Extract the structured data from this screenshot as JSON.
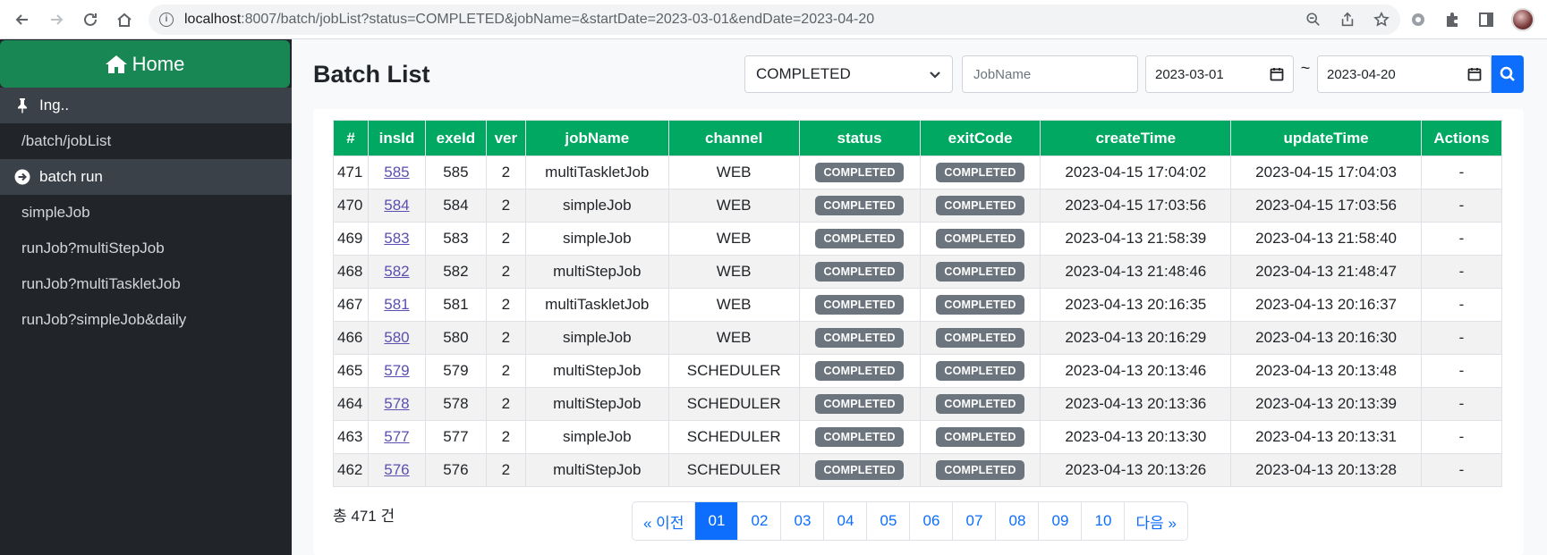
{
  "browser": {
    "url_host": "localhost",
    "url_rest": ":8007/batch/jobList?status=COMPLETED&jobName=&startDate=2023-03-01&endDate=2023-04-20"
  },
  "sidebar": {
    "home_label": "Home",
    "group_ing": "Ing..",
    "joblist_link": "/batch/jobList",
    "group_run": "batch run",
    "items": [
      "simpleJob",
      "runJob?multiStepJob",
      "runJob?multiTaskletJob",
      "runJob?simpleJob&daily"
    ]
  },
  "main": {
    "title": "Batch List",
    "status_select": "COMPLETED",
    "job_name_placeholder": "JobName",
    "start_date": "2023-03-01",
    "range_sep": "~",
    "end_date": "2023-04-20"
  },
  "table": {
    "headers": [
      "#",
      "insId",
      "exeId",
      "ver",
      "jobName",
      "channel",
      "status",
      "exitCode",
      "createTime",
      "updateTime",
      "Actions"
    ],
    "rows": [
      {
        "n": "471",
        "ins": "585",
        "exe": "585",
        "ver": "2",
        "job": "multiTaskletJob",
        "ch": "WEB",
        "status": "COMPLETED",
        "exit": "COMPLETED",
        "create": "2023-04-15 17:04:02",
        "update": "2023-04-15 17:04:03",
        "act": "-"
      },
      {
        "n": "470",
        "ins": "584",
        "exe": "584",
        "ver": "2",
        "job": "simpleJob",
        "ch": "WEB",
        "status": "COMPLETED",
        "exit": "COMPLETED",
        "create": "2023-04-15 17:03:56",
        "update": "2023-04-15 17:03:56",
        "act": "-"
      },
      {
        "n": "469",
        "ins": "583",
        "exe": "583",
        "ver": "2",
        "job": "simpleJob",
        "ch": "WEB",
        "status": "COMPLETED",
        "exit": "COMPLETED",
        "create": "2023-04-13 21:58:39",
        "update": "2023-04-13 21:58:40",
        "act": "-"
      },
      {
        "n": "468",
        "ins": "582",
        "exe": "582",
        "ver": "2",
        "job": "multiStepJob",
        "ch": "WEB",
        "status": "COMPLETED",
        "exit": "COMPLETED",
        "create": "2023-04-13 21:48:46",
        "update": "2023-04-13 21:48:47",
        "act": "-"
      },
      {
        "n": "467",
        "ins": "581",
        "exe": "581",
        "ver": "2",
        "job": "multiTaskletJob",
        "ch": "WEB",
        "status": "COMPLETED",
        "exit": "COMPLETED",
        "create": "2023-04-13 20:16:35",
        "update": "2023-04-13 20:16:37",
        "act": "-"
      },
      {
        "n": "466",
        "ins": "580",
        "exe": "580",
        "ver": "2",
        "job": "simpleJob",
        "ch": "WEB",
        "status": "COMPLETED",
        "exit": "COMPLETED",
        "create": "2023-04-13 20:16:29",
        "update": "2023-04-13 20:16:30",
        "act": "-"
      },
      {
        "n": "465",
        "ins": "579",
        "exe": "579",
        "ver": "2",
        "job": "multiStepJob",
        "ch": "SCHEDULER",
        "status": "COMPLETED",
        "exit": "COMPLETED",
        "create": "2023-04-13 20:13:46",
        "update": "2023-04-13 20:13:48",
        "act": "-"
      },
      {
        "n": "464",
        "ins": "578",
        "exe": "578",
        "ver": "2",
        "job": "multiStepJob",
        "ch": "SCHEDULER",
        "status": "COMPLETED",
        "exit": "COMPLETED",
        "create": "2023-04-13 20:13:36",
        "update": "2023-04-13 20:13:39",
        "act": "-"
      },
      {
        "n": "463",
        "ins": "577",
        "exe": "577",
        "ver": "2",
        "job": "simpleJob",
        "ch": "SCHEDULER",
        "status": "COMPLETED",
        "exit": "COMPLETED",
        "create": "2023-04-13 20:13:30",
        "update": "2023-04-13 20:13:31",
        "act": "-"
      },
      {
        "n": "462",
        "ins": "576",
        "exe": "576",
        "ver": "2",
        "job": "multiStepJob",
        "ch": "SCHEDULER",
        "status": "COMPLETED",
        "exit": "COMPLETED",
        "create": "2023-04-13 20:13:26",
        "update": "2023-04-13 20:13:28",
        "act": "-"
      }
    ]
  },
  "footer": {
    "total": "총 471 건",
    "prev": "« 이전",
    "pages": [
      "01",
      "02",
      "03",
      "04",
      "05",
      "06",
      "07",
      "08",
      "09",
      "10"
    ],
    "active_page": "01",
    "next": "다음 »"
  },
  "colors": {
    "home_green": "#198754",
    "header_green": "#00a862",
    "primary_blue": "#0d6efd",
    "badge_gray": "#6c757d",
    "sidebar_dark": "#212529"
  }
}
